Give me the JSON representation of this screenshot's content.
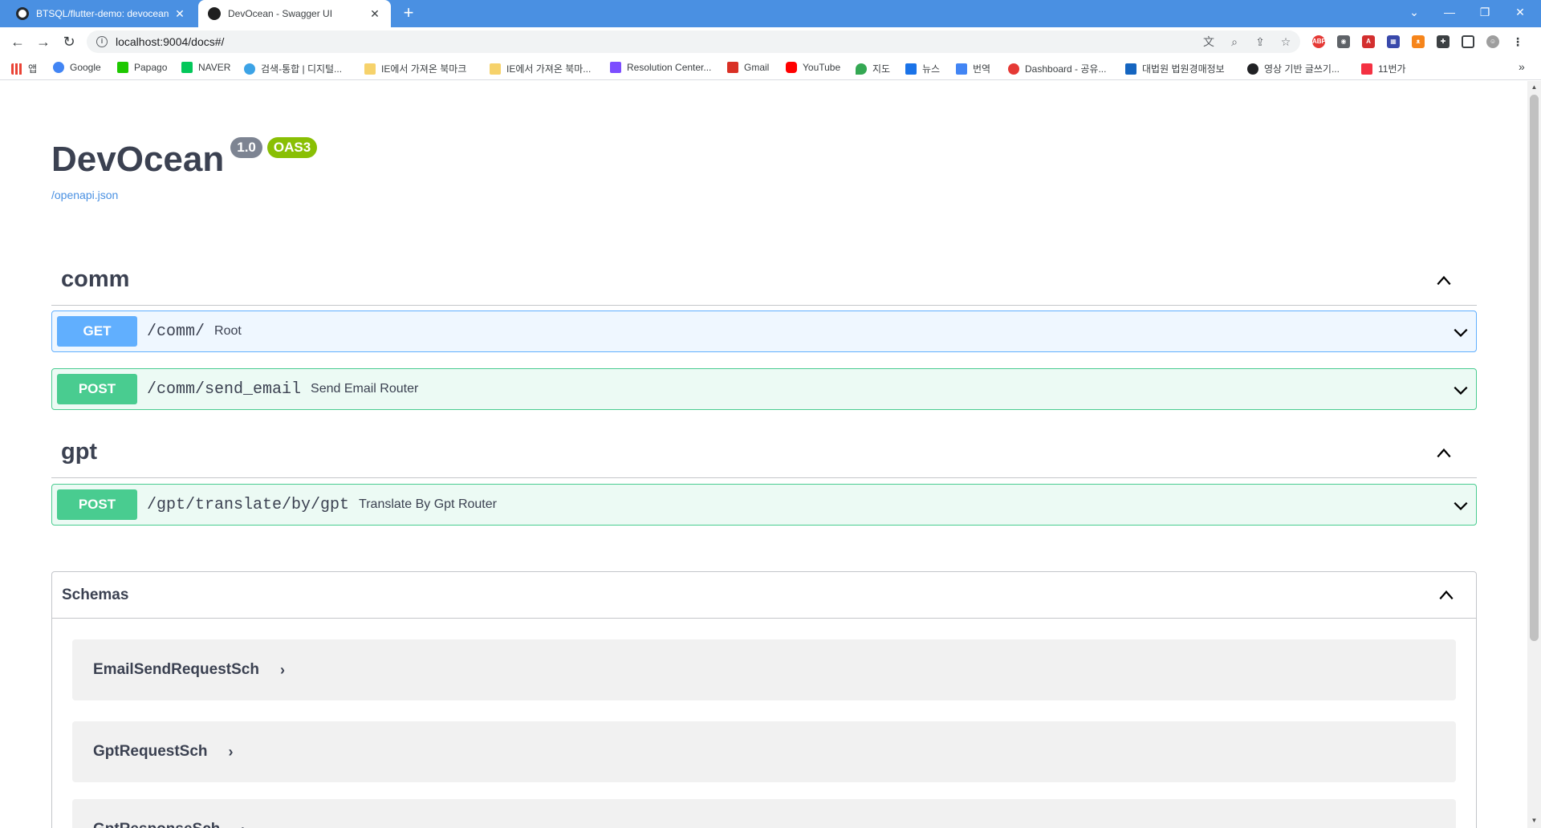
{
  "browser": {
    "tabs": [
      {
        "title": "BTSQL/flutter-demo: devocean",
        "close": "✕"
      },
      {
        "title": "DevOcean - Swagger UI",
        "close": "✕"
      }
    ],
    "new_tab": "+",
    "url": "localhost:9004/docs#/",
    "bookmarks": [
      {
        "label": "앱",
        "color": "#ea4335"
      },
      {
        "label": "Google",
        "color": "#4285f4"
      },
      {
        "label": "Papago",
        "color": "#1ec800"
      },
      {
        "label": "NAVER",
        "color": "#03c75a"
      },
      {
        "label": "검색-통합 | 디지털...",
        "color": "#3ca3e6"
      },
      {
        "label": "IE에서 가져온 북마크",
        "color": "#f6d26b"
      },
      {
        "label": "IE에서 가져온 북마...",
        "color": "#f6d26b"
      },
      {
        "label": "Resolution Center...",
        "color": "#7c4dff"
      },
      {
        "label": "Gmail",
        "color": "#d93025"
      },
      {
        "label": "YouTube",
        "color": "#ff0000"
      },
      {
        "label": "지도",
        "color": "#34a853"
      },
      {
        "label": "뉴스",
        "color": "#1a73e8"
      },
      {
        "label": "번역",
        "color": "#4285f4"
      },
      {
        "label": "Dashboard - 공유...",
        "color": "#e53935"
      },
      {
        "label": "대법원 법원경매정보",
        "color": "#1565c0"
      },
      {
        "label": "영상 기반 글쓰기...",
        "color": "#202124"
      },
      {
        "label": "11번가",
        "color": "#f43142"
      }
    ],
    "bookmarks_more": "»"
  },
  "swagger": {
    "title": "DevOcean",
    "version": "1.0",
    "oas": "OAS3",
    "spec_link": "/openapi.json",
    "sections": [
      {
        "tag": "comm",
        "operations": [
          {
            "method": "GET",
            "path": "/comm/",
            "summary": "Root"
          },
          {
            "method": "POST",
            "path": "/comm/send_email",
            "summary": "Send Email Router"
          }
        ]
      },
      {
        "tag": "gpt",
        "operations": [
          {
            "method": "POST",
            "path": "/gpt/translate/by/gpt",
            "summary": "Translate By Gpt Router"
          }
        ]
      }
    ],
    "schemas_title": "Schemas",
    "schemas": [
      "EmailSendRequestSch",
      "GptRequestSch",
      "GptResponseSch"
    ],
    "model_arrow": "›"
  },
  "colors": {
    "get": "#61affe",
    "post": "#49cc90",
    "oas_badge": "#89bf04",
    "version_badge": "#7d8492",
    "tab_strip": "#4a90e2",
    "link": "#4990e2"
  }
}
